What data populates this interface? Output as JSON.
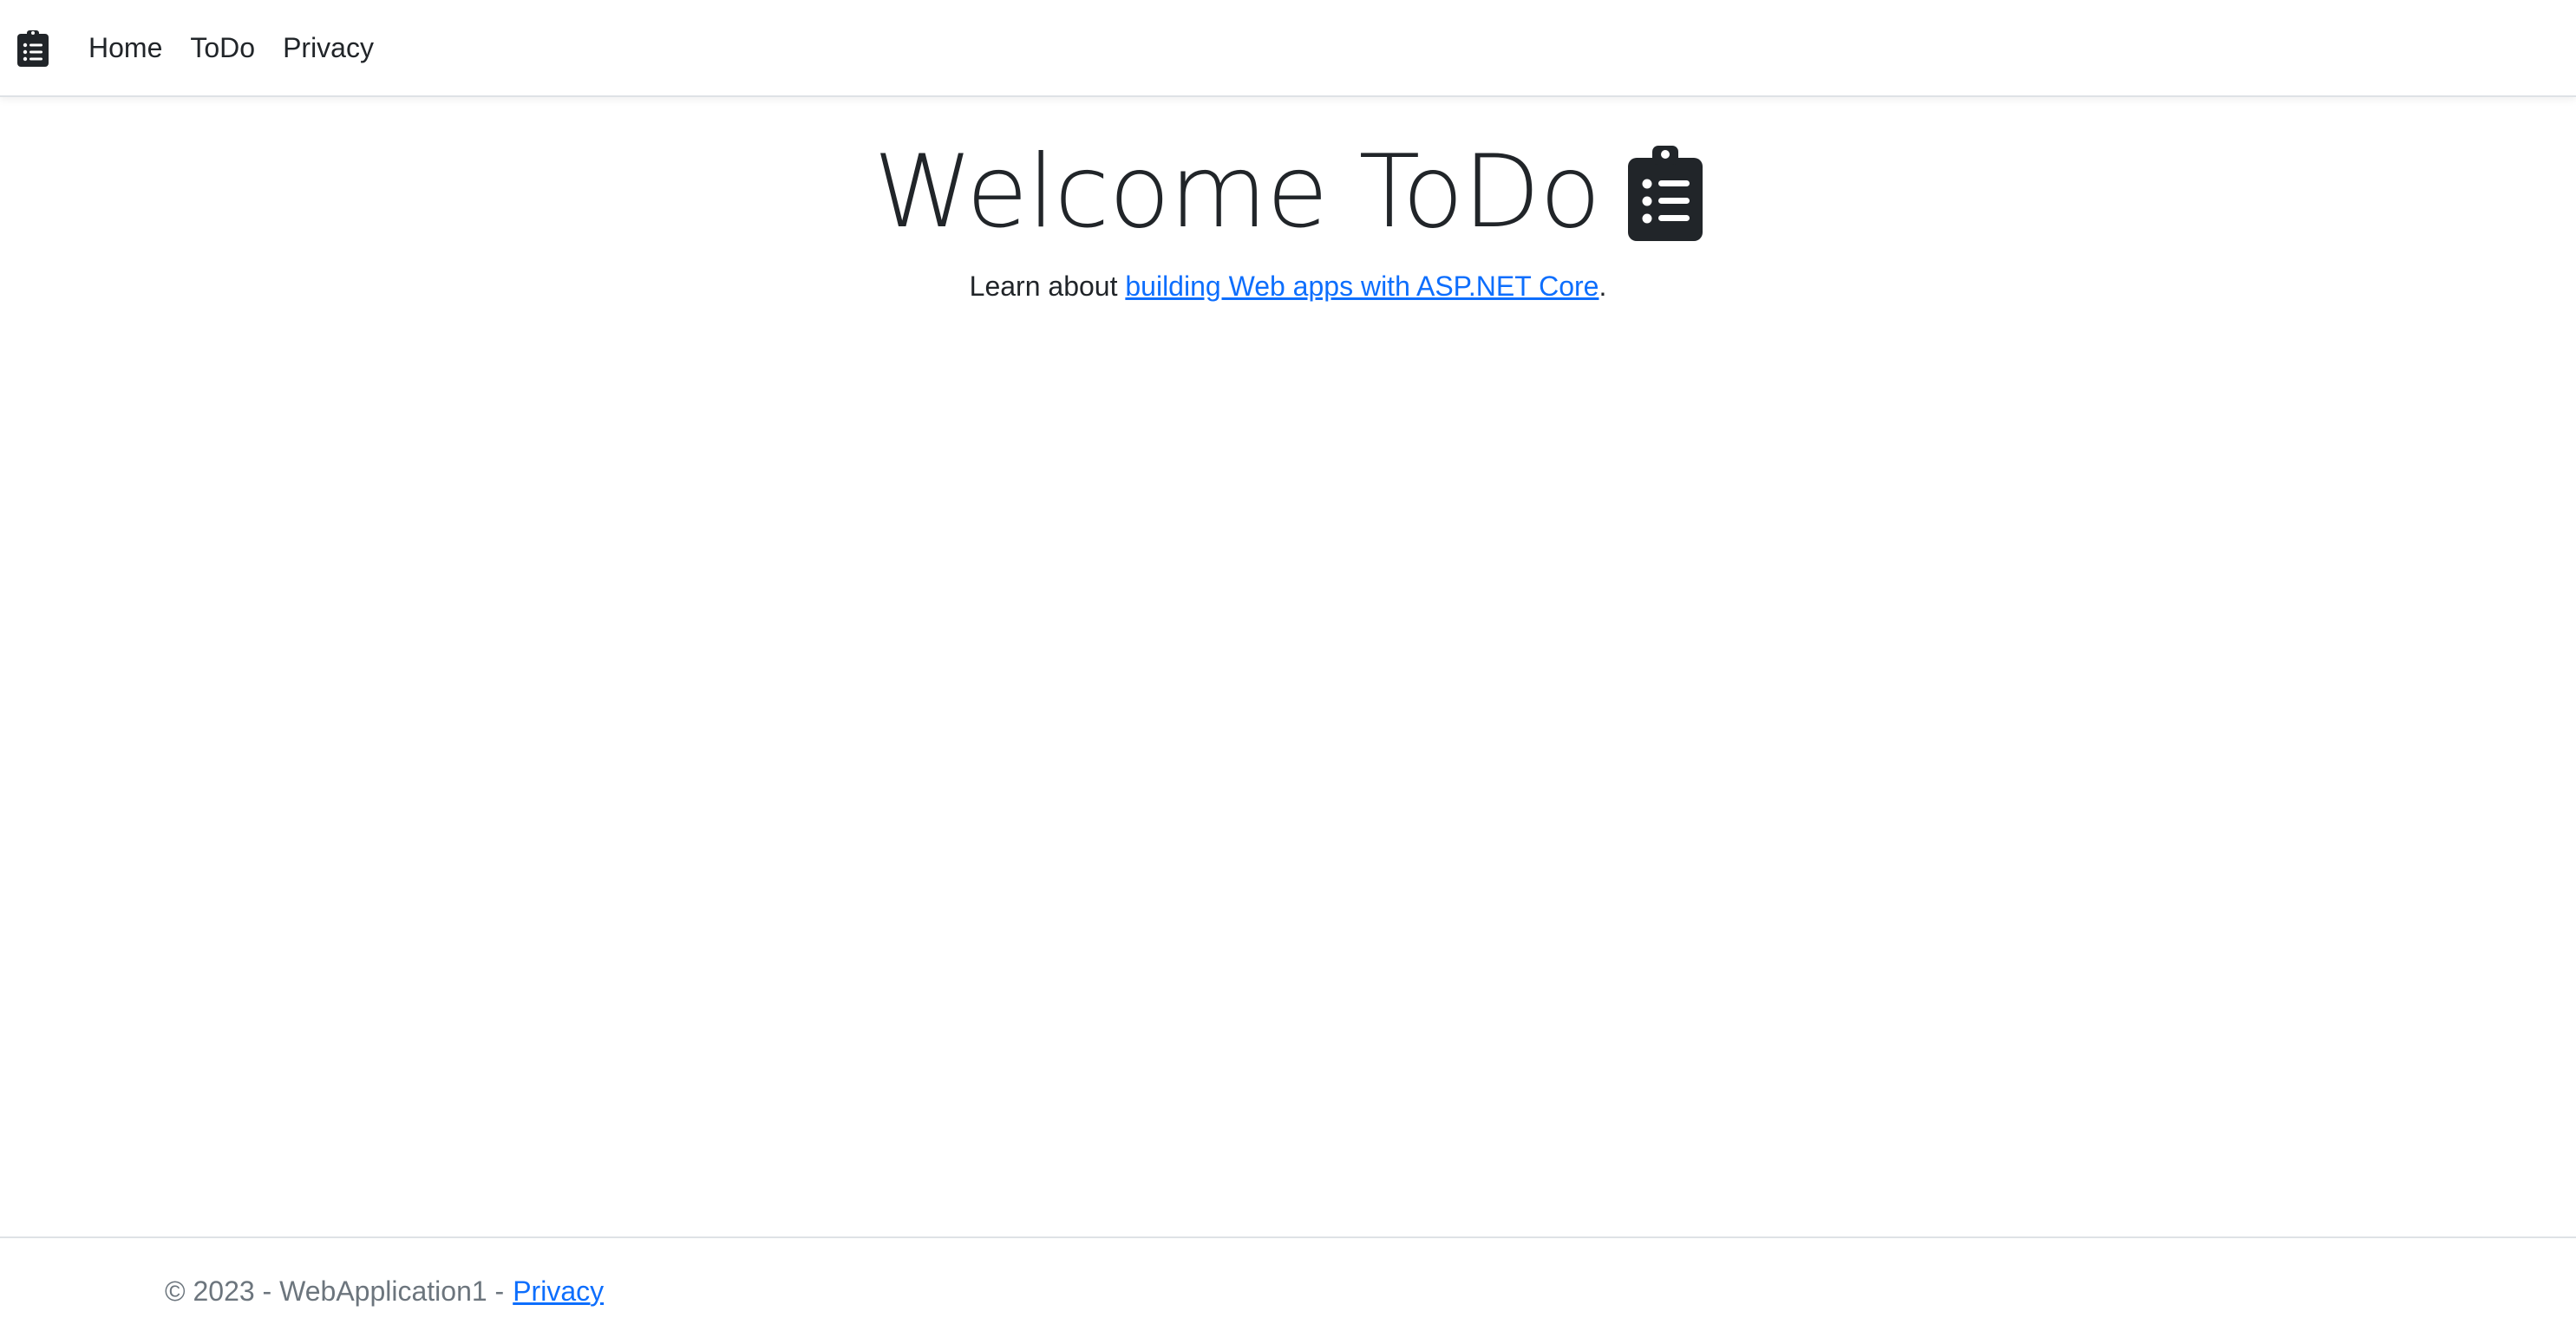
{
  "navbar": {
    "brand_icon": "clipboard-list-icon",
    "items": [
      {
        "label": "Home"
      },
      {
        "label": "ToDo"
      },
      {
        "label": "Privacy"
      }
    ]
  },
  "main": {
    "heading": "Welcome ToDo",
    "heading_icon": "clipboard-list-icon",
    "lead_prefix": "Learn about ",
    "lead_link": "building Web apps with ASP.NET Core",
    "lead_suffix": "."
  },
  "footer": {
    "copyright": "© 2023 - WebApplication1 -",
    "privacy_link": "Privacy"
  },
  "colors": {
    "link": "#0d6efd",
    "text": "#212529",
    "muted": "#6c757d",
    "border": "#dee2e6"
  }
}
